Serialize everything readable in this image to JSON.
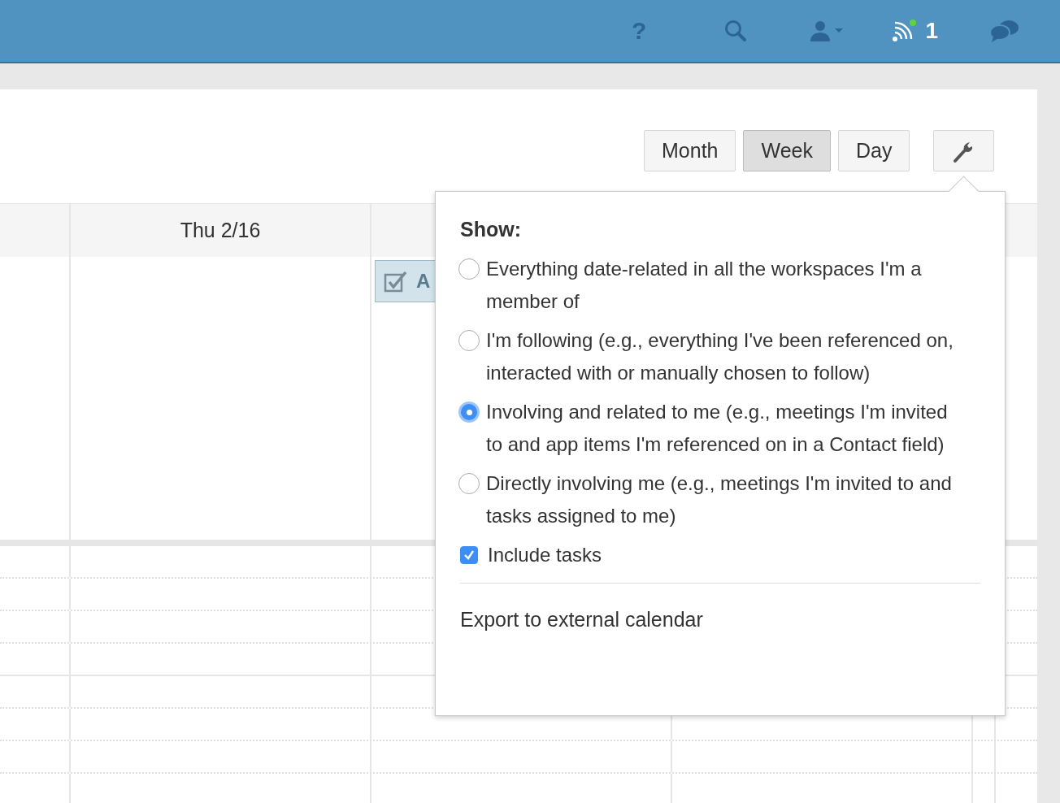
{
  "top_bar": {
    "help": "?",
    "notification_count": "1",
    "notification_unread": true
  },
  "view_buttons": [
    {
      "label": "Month",
      "selected": false
    },
    {
      "label": "Week",
      "selected": true
    },
    {
      "label": "Day",
      "selected": false
    }
  ],
  "calendar": {
    "day_header": "Thu 2/16",
    "event": {
      "title": "A",
      "done": true
    }
  },
  "settings_popover": {
    "heading": "Show:",
    "options": [
      {
        "kind": "radio",
        "label": "Everything date-related in all the workspaces I'm a member of",
        "selected": false
      },
      {
        "kind": "radio",
        "label": "I'm following (e.g., everything I've been referenced on, interacted with or manually chosen to follow)",
        "selected": false
      },
      {
        "kind": "radio",
        "label": "Involving and related to me (e.g., meetings I'm invited to and app items I'm referenced on in a Contact field)",
        "selected": true
      },
      {
        "kind": "radio",
        "label": "Directly involving me (e.g., meetings I'm invited to and tasks assigned to me)",
        "selected": false
      },
      {
        "kind": "checkbox",
        "label": "Include tasks",
        "checked": true
      }
    ],
    "export_link": "Export to external calendar"
  }
}
